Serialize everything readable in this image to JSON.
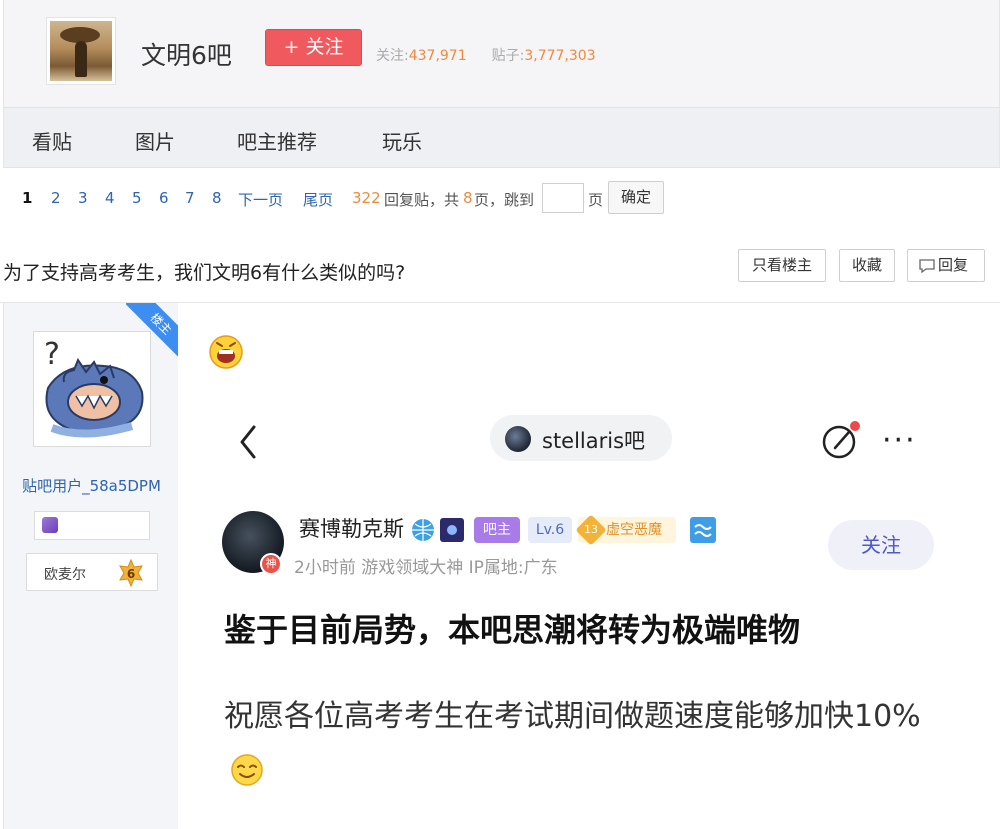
{
  "forum": {
    "name": "文明6吧",
    "follow_label": "+ 关注",
    "follow_caption": "关注:",
    "follow_count": "437,971",
    "post_caption": "贴子:",
    "post_count": "3,777,303"
  },
  "nav": {
    "items": [
      "看贴",
      "图片",
      "吧主推荐",
      "玩乐"
    ]
  },
  "pager": {
    "pages": [
      "1",
      "2",
      "3",
      "4",
      "5",
      "6",
      "7",
      "8"
    ],
    "current": "1",
    "next_label": "下一页",
    "last_label": "尾页",
    "reply_count": "322",
    "reply_text": "回复贴，共",
    "total_pages": "8",
    "pages_text": "页，跳到",
    "page_suffix": "页",
    "ok_label": "确定"
  },
  "thread": {
    "title": "为了支持高考考生，我们文明6有什么类似的吗?",
    "only_op_label": "只看楼主",
    "collect_label": "收藏",
    "reply_label": "回复"
  },
  "author": {
    "ribbon": "楼主",
    "username": "贴吧用户_58a5DPM",
    "level_title": "欧麦尔",
    "level": "6"
  },
  "screenshot": {
    "forum_pill": "stellaris吧",
    "poster_name": "赛博勒克斯",
    "poster_badge": "神",
    "tags": {
      "admin": "吧主",
      "level": "Lv.6",
      "rank_num": "13",
      "rank_name": "虚空恶魔"
    },
    "meta": "2小时前    游戏领域大神  IP属地:广东",
    "follow_label": "关注",
    "post_title": "鉴于目前局势，本吧思潮将转为极端唯物",
    "post_body": "祝愿各位高考考生在考试期间做题速度能够加快10%"
  },
  "colors": {
    "follow_red": "#f05a5f",
    "link_blue": "#2d64b3",
    "count_orange": "#f0893c",
    "ribbon_blue": "#3e8df0"
  },
  "icons": [
    "forum-avatar",
    "user-avatar",
    "smile-emoji",
    "back-arrow-icon",
    "edit-icon",
    "more-icon",
    "tip-emoji"
  ]
}
